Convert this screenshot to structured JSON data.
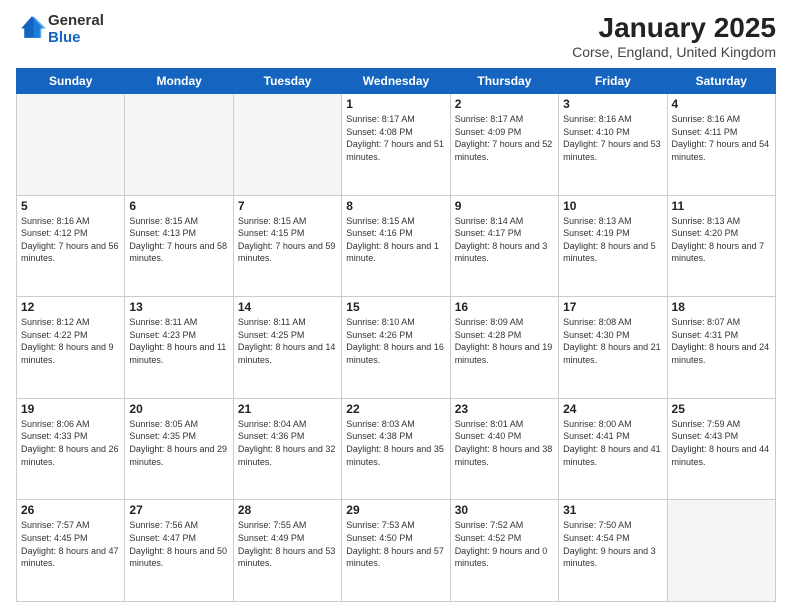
{
  "header": {
    "logo_general": "General",
    "logo_blue": "Blue",
    "title": "January 2025",
    "subtitle": "Corse, England, United Kingdom"
  },
  "days_of_week": [
    "Sunday",
    "Monday",
    "Tuesday",
    "Wednesday",
    "Thursday",
    "Friday",
    "Saturday"
  ],
  "weeks": [
    [
      {
        "day": null,
        "info": null
      },
      {
        "day": null,
        "info": null
      },
      {
        "day": null,
        "info": null
      },
      {
        "day": "1",
        "info": "Sunrise: 8:17 AM\nSunset: 4:08 PM\nDaylight: 7 hours and 51 minutes."
      },
      {
        "day": "2",
        "info": "Sunrise: 8:17 AM\nSunset: 4:09 PM\nDaylight: 7 hours and 52 minutes."
      },
      {
        "day": "3",
        "info": "Sunrise: 8:16 AM\nSunset: 4:10 PM\nDaylight: 7 hours and 53 minutes."
      },
      {
        "day": "4",
        "info": "Sunrise: 8:16 AM\nSunset: 4:11 PM\nDaylight: 7 hours and 54 minutes."
      }
    ],
    [
      {
        "day": "5",
        "info": "Sunrise: 8:16 AM\nSunset: 4:12 PM\nDaylight: 7 hours and 56 minutes."
      },
      {
        "day": "6",
        "info": "Sunrise: 8:15 AM\nSunset: 4:13 PM\nDaylight: 7 hours and 58 minutes."
      },
      {
        "day": "7",
        "info": "Sunrise: 8:15 AM\nSunset: 4:15 PM\nDaylight: 7 hours and 59 minutes."
      },
      {
        "day": "8",
        "info": "Sunrise: 8:15 AM\nSunset: 4:16 PM\nDaylight: 8 hours and 1 minute."
      },
      {
        "day": "9",
        "info": "Sunrise: 8:14 AM\nSunset: 4:17 PM\nDaylight: 8 hours and 3 minutes."
      },
      {
        "day": "10",
        "info": "Sunrise: 8:13 AM\nSunset: 4:19 PM\nDaylight: 8 hours and 5 minutes."
      },
      {
        "day": "11",
        "info": "Sunrise: 8:13 AM\nSunset: 4:20 PM\nDaylight: 8 hours and 7 minutes."
      }
    ],
    [
      {
        "day": "12",
        "info": "Sunrise: 8:12 AM\nSunset: 4:22 PM\nDaylight: 8 hours and 9 minutes."
      },
      {
        "day": "13",
        "info": "Sunrise: 8:11 AM\nSunset: 4:23 PM\nDaylight: 8 hours and 11 minutes."
      },
      {
        "day": "14",
        "info": "Sunrise: 8:11 AM\nSunset: 4:25 PM\nDaylight: 8 hours and 14 minutes."
      },
      {
        "day": "15",
        "info": "Sunrise: 8:10 AM\nSunset: 4:26 PM\nDaylight: 8 hours and 16 minutes."
      },
      {
        "day": "16",
        "info": "Sunrise: 8:09 AM\nSunset: 4:28 PM\nDaylight: 8 hours and 19 minutes."
      },
      {
        "day": "17",
        "info": "Sunrise: 8:08 AM\nSunset: 4:30 PM\nDaylight: 8 hours and 21 minutes."
      },
      {
        "day": "18",
        "info": "Sunrise: 8:07 AM\nSunset: 4:31 PM\nDaylight: 8 hours and 24 minutes."
      }
    ],
    [
      {
        "day": "19",
        "info": "Sunrise: 8:06 AM\nSunset: 4:33 PM\nDaylight: 8 hours and 26 minutes."
      },
      {
        "day": "20",
        "info": "Sunrise: 8:05 AM\nSunset: 4:35 PM\nDaylight: 8 hours and 29 minutes."
      },
      {
        "day": "21",
        "info": "Sunrise: 8:04 AM\nSunset: 4:36 PM\nDaylight: 8 hours and 32 minutes."
      },
      {
        "day": "22",
        "info": "Sunrise: 8:03 AM\nSunset: 4:38 PM\nDaylight: 8 hours and 35 minutes."
      },
      {
        "day": "23",
        "info": "Sunrise: 8:01 AM\nSunset: 4:40 PM\nDaylight: 8 hours and 38 minutes."
      },
      {
        "day": "24",
        "info": "Sunrise: 8:00 AM\nSunset: 4:41 PM\nDaylight: 8 hours and 41 minutes."
      },
      {
        "day": "25",
        "info": "Sunrise: 7:59 AM\nSunset: 4:43 PM\nDaylight: 8 hours and 44 minutes."
      }
    ],
    [
      {
        "day": "26",
        "info": "Sunrise: 7:57 AM\nSunset: 4:45 PM\nDaylight: 8 hours and 47 minutes."
      },
      {
        "day": "27",
        "info": "Sunrise: 7:56 AM\nSunset: 4:47 PM\nDaylight: 8 hours and 50 minutes."
      },
      {
        "day": "28",
        "info": "Sunrise: 7:55 AM\nSunset: 4:49 PM\nDaylight: 8 hours and 53 minutes."
      },
      {
        "day": "29",
        "info": "Sunrise: 7:53 AM\nSunset: 4:50 PM\nDaylight: 8 hours and 57 minutes."
      },
      {
        "day": "30",
        "info": "Sunrise: 7:52 AM\nSunset: 4:52 PM\nDaylight: 9 hours and 0 minutes."
      },
      {
        "day": "31",
        "info": "Sunrise: 7:50 AM\nSunset: 4:54 PM\nDaylight: 9 hours and 3 minutes."
      },
      {
        "day": null,
        "info": null
      }
    ]
  ]
}
